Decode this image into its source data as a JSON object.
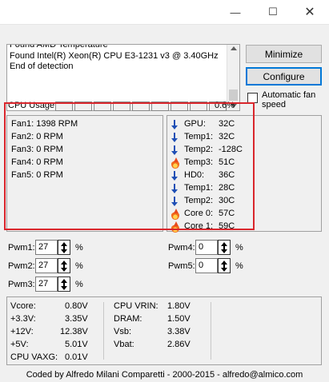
{
  "window": {
    "minimize_glyph": "—",
    "maximize_glyph": "☐",
    "close_glyph": "✕"
  },
  "log": {
    "lines": [
      "Found AMD Temperature",
      "Found Intel(R) Xeon(R) CPU E3-1231 v3 @ 3.40GHz",
      "End of detection"
    ]
  },
  "buttons": {
    "minimize": "Minimize",
    "configure": "Configure"
  },
  "auto_fan": {
    "label": "Automatic fan speed",
    "checked": false
  },
  "cpu_usage": {
    "label": "CPU Usage",
    "value": "0.6%",
    "cells": 9
  },
  "fans": [
    {
      "name": "Fan1:",
      "value": "1398 RPM"
    },
    {
      "name": "Fan2:",
      "value": "0 RPM"
    },
    {
      "name": "Fan3:",
      "value": "0 RPM"
    },
    {
      "name": "Fan4:",
      "value": "0 RPM"
    },
    {
      "name": "Fan5:",
      "value": "0 RPM"
    }
  ],
  "temps": [
    {
      "name": "GPU:",
      "value": "32C",
      "icon": "arrow-down-icon"
    },
    {
      "name": "Temp1:",
      "value": "32C",
      "icon": "arrow-down-icon"
    },
    {
      "name": "Temp2:",
      "value": "-128C",
      "icon": "arrow-down-icon"
    },
    {
      "name": "Temp3:",
      "value": "51C",
      "icon": "flame-icon"
    },
    {
      "name": "HD0:",
      "value": "36C",
      "icon": "arrow-down-icon"
    },
    {
      "name": "Temp1:",
      "value": "28C",
      "icon": "arrow-down-icon"
    },
    {
      "name": "Temp2:",
      "value": "30C",
      "icon": "arrow-down-icon"
    },
    {
      "name": "Core 0:",
      "value": "57C",
      "icon": "flame-icon"
    },
    {
      "name": "Core 1:",
      "value": "59C",
      "icon": "flame-icon"
    }
  ],
  "pwm": [
    {
      "label": "Pwm1:",
      "value": "27",
      "unit": "%"
    },
    {
      "label": "Pwm2:",
      "value": "27",
      "unit": "%"
    },
    {
      "label": "Pwm3:",
      "value": "27",
      "unit": "%"
    },
    {
      "label": "Pwm4:",
      "value": "0",
      "unit": "%"
    },
    {
      "label": "Pwm5:",
      "value": "0",
      "unit": "%"
    }
  ],
  "voltages_left": [
    {
      "name": "Vcore:",
      "value": "0.80V"
    },
    {
      "name": "+3.3V:",
      "value": "3.35V"
    },
    {
      "name": "+12V:",
      "value": "12.38V"
    },
    {
      "name": "+5V:",
      "value": "5.01V"
    },
    {
      "name": "CPU VAXG:",
      "value": "0.01V"
    }
  ],
  "voltages_right": [
    {
      "name": "CPU VRIN:",
      "value": "1.80V"
    },
    {
      "name": "DRAM:",
      "value": "1.50V"
    },
    {
      "name": "Vsb:",
      "value": "3.38V"
    },
    {
      "name": "Vbat:",
      "value": "2.86V"
    }
  ],
  "footer": {
    "text": "Coded by Alfredo Milani Comparetti - 2000-2015 - alfredo@almico.com"
  },
  "colors": {
    "highlight": "#d9262c",
    "arrow": "#1f4fb5",
    "flame": "#f26b1d"
  }
}
